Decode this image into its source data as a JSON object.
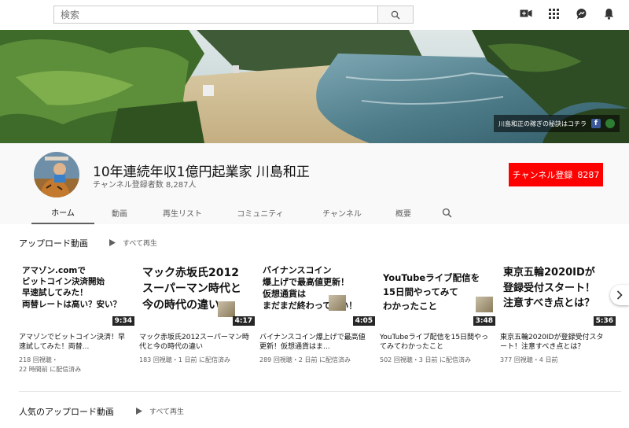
{
  "search": {
    "placeholder": "検索"
  },
  "banner": {
    "link_text": "川島和正の稼ぎの秘訣はコチラ",
    "fb": "f"
  },
  "channel": {
    "name": "10年連続年収1億円起業家 川島和正",
    "subscribers": "チャンネル登録者数 8,287人",
    "subscribe_label": "チャンネル登録",
    "subscribe_count": "8287"
  },
  "tabs": [
    "ホーム",
    "動画",
    "再生リスト",
    "コミュニティ",
    "チャンネル",
    "概要"
  ],
  "sections": {
    "uploads": {
      "title": "アップロード動画",
      "play_all": "すべて再生"
    },
    "popular": {
      "title": "人気のアップロード動画",
      "play_all": "すべて再生"
    }
  },
  "videos": [
    {
      "thumb_lines": [
        "アマゾン.comで",
        "ビットコイン決済開始",
        "早速試してみた！",
        "両替レートは高い？安い？"
      ],
      "duration": "9:34",
      "title": "アマゾンでビットコイン決済！早速試してみた！両替...",
      "views": "218 回視聴・",
      "age": "22 時間前 に配信済み"
    },
    {
      "thumb_lines": [
        "マック赤坂氏2012",
        "スーパーマン時代と",
        "今の時代の違い"
      ],
      "duration": "4:17",
      "title": "マック赤坂氏2012スーパーマン時代と今の時代の違い",
      "views": "183 回視聴・1 日前 に配信済み",
      "age": ""
    },
    {
      "thumb_lines": [
        "バイナンスコイン",
        "爆上げで最高値更新！",
        "仮想通貨は",
        "まだまだ終わってない！"
      ],
      "duration": "4:05",
      "title": "バイナンスコイン爆上げで最高値更新！仮想通貨はま...",
      "views": "289 回視聴・2 日前 に配信済み",
      "age": ""
    },
    {
      "thumb_lines": [
        "YouTubeライブ配信を",
        "15日間やってみて",
        "わかったこと"
      ],
      "duration": "3:48",
      "title": "YouTubeライブ配信を15日間やってみてわかったこと",
      "views": "502 回視聴・3 日前 に配信済み",
      "age": ""
    },
    {
      "thumb_lines": [
        "東京五輪2020IDが",
        "登録受付スタート！",
        "注意すべき点とは？"
      ],
      "duration": "5:36",
      "title": "東京五輪2020IDが登録受付スタート！注意すべき点とは？",
      "views": "377 回視聴・4 日前",
      "age": ""
    }
  ]
}
